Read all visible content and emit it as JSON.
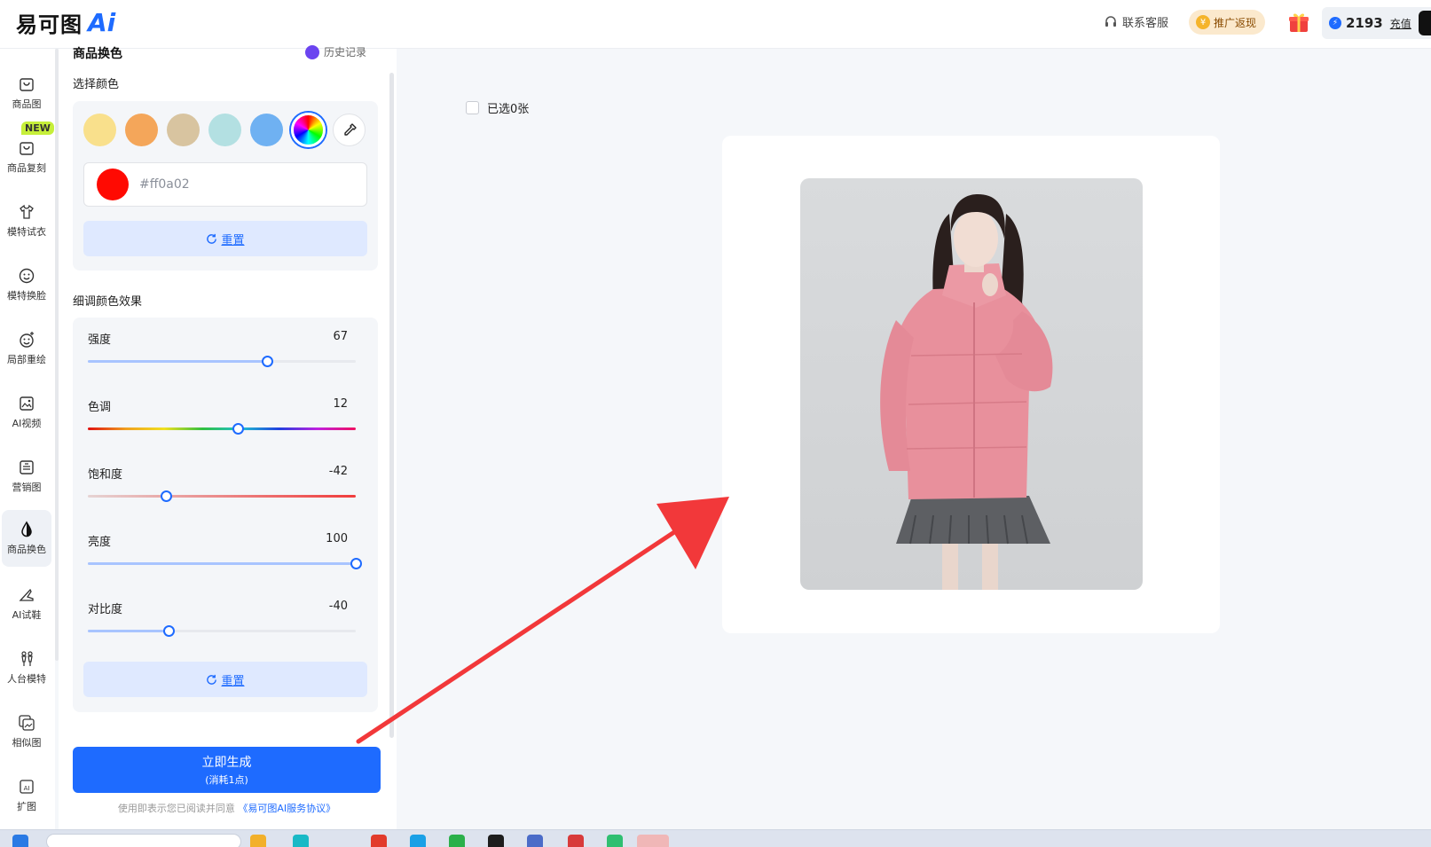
{
  "header": {
    "logo_text": "易可图",
    "logo_ai": "Ai",
    "service_label": "联系客服",
    "promo_label": "推广返现",
    "points": "2193",
    "recharge_label": "充值"
  },
  "nav": {
    "new_badge": "NEW",
    "items": [
      {
        "label": "商品图",
        "icon": "product-image-icon"
      },
      {
        "label": "商品复刻",
        "icon": "product-copy-icon"
      },
      {
        "label": "模特试衣",
        "icon": "tshirt-icon"
      },
      {
        "label": "模特换脸",
        "icon": "face-icon"
      },
      {
        "label": "局部重绘",
        "icon": "face-sparkle-icon"
      },
      {
        "label": "AI视频",
        "icon": "video-icon"
      },
      {
        "label": "营销图",
        "icon": "marketing-icon"
      },
      {
        "label": "商品换色",
        "icon": "color-drop-icon"
      },
      {
        "label": "AI试鞋",
        "icon": "shoe-icon"
      },
      {
        "label": "人台模特",
        "icon": "mannequin-icon"
      },
      {
        "label": "相似图",
        "icon": "similar-image-icon"
      },
      {
        "label": "扩图",
        "icon": "expand-image-icon"
      }
    ],
    "active_index": 7
  },
  "panel": {
    "title": "商品换色",
    "history_label": "历史记录",
    "choose_color_label": "选择颜色",
    "swatches": [
      "#f9e08c",
      "#f4a65a",
      "#d8c4a0",
      "#b3e0e2",
      "#6fb1f2"
    ],
    "hex_value": "#ff0a02",
    "reset_label": "重置",
    "fine_tune_label": "细调颜色效果",
    "sliders": [
      {
        "label": "强度",
        "value": "67",
        "fraction": 0.67,
        "kind": "plain"
      },
      {
        "label": "色调",
        "value": "12",
        "fraction": 0.56,
        "kind": "hue"
      },
      {
        "label": "饱和度",
        "value": "-42",
        "fraction": 0.29,
        "kind": "saturation"
      },
      {
        "label": "亮度",
        "value": "100",
        "fraction": 1.0,
        "kind": "plain"
      },
      {
        "label": "对比度",
        "value": "-40",
        "fraction": 0.3,
        "kind": "plain"
      }
    ],
    "reset2_label": "重置",
    "generate_label": "立即生成",
    "generate_cost": "(消耗1点)",
    "agree_text": "使用即表示您已阅读并同意",
    "agree_link": "《易可图AI服务协议》"
  },
  "main": {
    "selected_label": "已选0张"
  },
  "colors": {
    "accent": "#1e6bff",
    "jacket": "#e8909c",
    "skirt": "#5d5f63",
    "arrow": "#f2383a"
  }
}
